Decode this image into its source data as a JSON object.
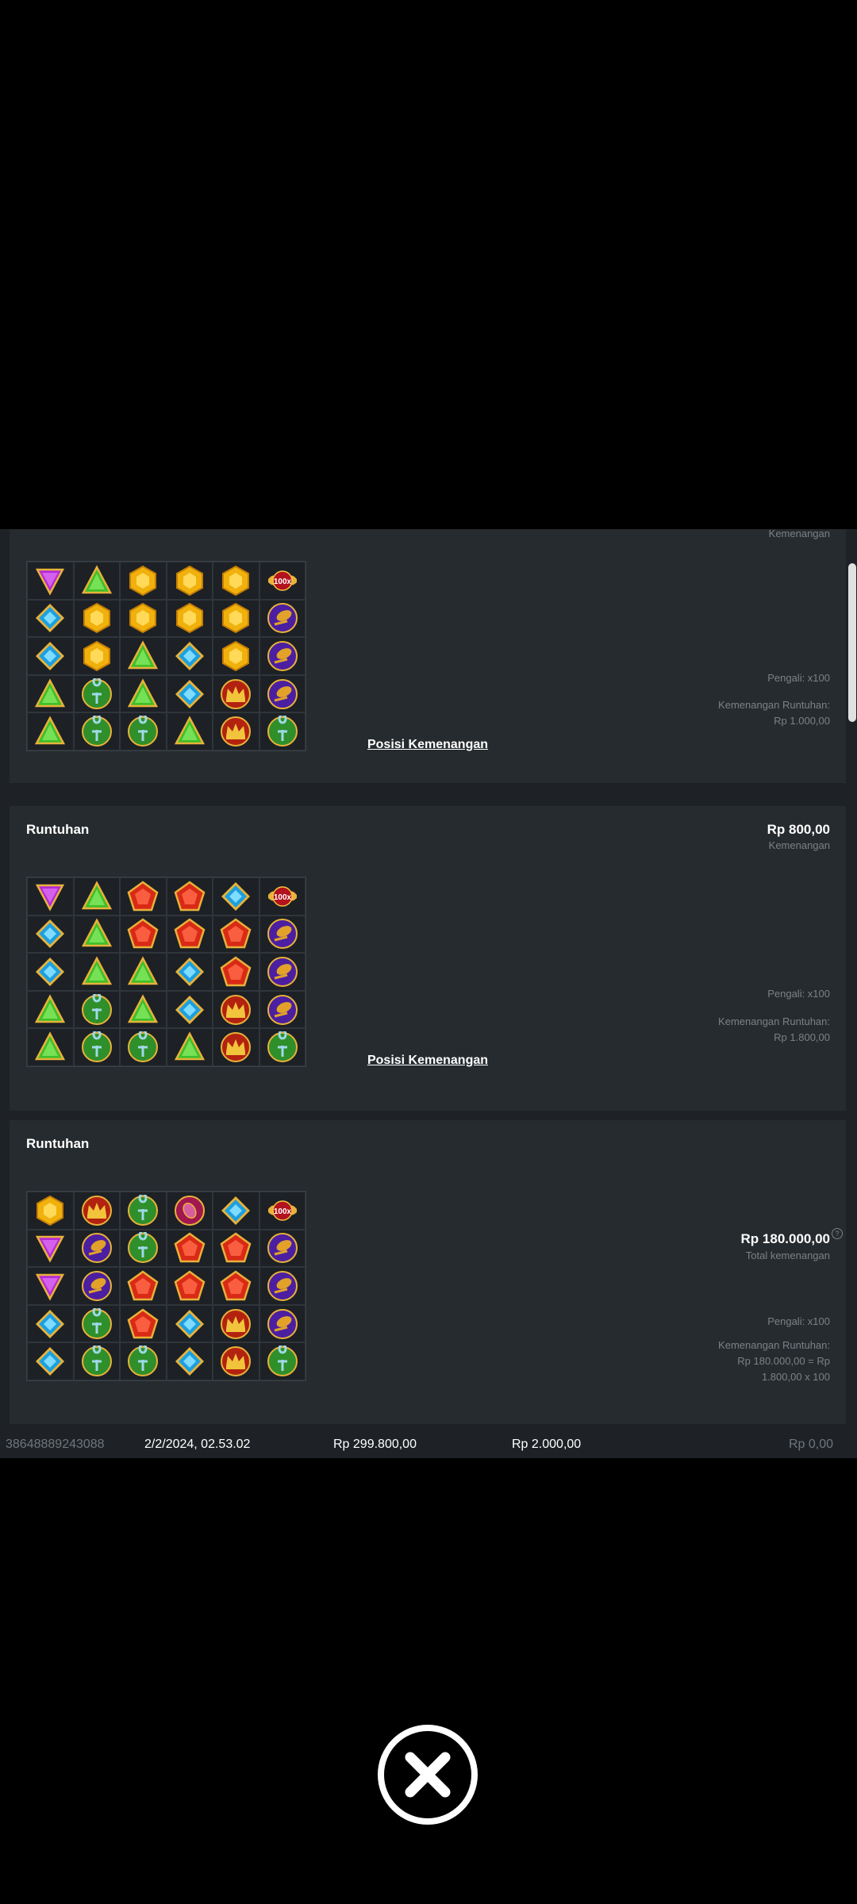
{
  "card1": {
    "win_label_top": "Kemenangan",
    "multiplier": "Pengali: x100",
    "cascade_label": "Kemenangan Runtuhan:",
    "cascade_value": "Rp 1.000,00",
    "link": "Posisi Kemenangan",
    "grid": [
      [
        "purple-triangle",
        "green-triangle",
        "gold-hexagon",
        "gold-hexagon",
        "gold-hexagon",
        "multiplier-100x"
      ],
      [
        "blue-diamond",
        "gold-hexagon",
        "gold-hexagon",
        "gold-hexagon",
        "gold-hexagon",
        "purple-scarab"
      ],
      [
        "blue-diamond",
        "gold-hexagon",
        "green-triangle",
        "blue-diamond",
        "gold-hexagon",
        "purple-scarab"
      ],
      [
        "green-triangle",
        "green-ankh",
        "green-triangle",
        "blue-diamond",
        "red-crown",
        "purple-scarab"
      ],
      [
        "green-triangle",
        "green-ankh",
        "green-ankh",
        "green-triangle",
        "red-crown",
        "green-ankh"
      ]
    ]
  },
  "card2": {
    "title": "Runtuhan",
    "amount": "Rp 800,00",
    "amount_label": "Kemenangan",
    "multiplier": "Pengali: x100",
    "cascade_label": "Kemenangan Runtuhan:",
    "cascade_value": "Rp 1.800,00",
    "link": "Posisi Kemenangan",
    "grid": [
      [
        "purple-triangle",
        "green-triangle",
        "red-pentagon",
        "red-pentagon",
        "blue-diamond",
        "multiplier-100x"
      ],
      [
        "blue-diamond",
        "green-triangle",
        "red-pentagon",
        "red-pentagon",
        "red-pentagon",
        "purple-scarab"
      ],
      [
        "blue-diamond",
        "green-triangle",
        "green-triangle",
        "blue-diamond",
        "red-pentagon",
        "purple-scarab"
      ],
      [
        "green-triangle",
        "green-ankh",
        "green-triangle",
        "blue-diamond",
        "red-crown",
        "purple-scarab"
      ],
      [
        "green-triangle",
        "green-ankh",
        "green-ankh",
        "green-triangle",
        "red-crown",
        "green-ankh"
      ]
    ]
  },
  "card3": {
    "title": "Runtuhan",
    "amount": "Rp 180.000,00",
    "amount_label": "Total kemenangan",
    "help": "?",
    "multiplier": "Pengali: x100",
    "cascade_label": "Kemenangan Runtuhan:",
    "cascade_value_1": "Rp 180.000,00 = Rp",
    "cascade_value_2": "1.800,00 x 100",
    "grid": [
      [
        "gold-hexagon",
        "red-crown",
        "green-ankh",
        "pink-scarab",
        "blue-diamond",
        "multiplier-100x"
      ],
      [
        "purple-triangle",
        "purple-scarab",
        "green-ankh",
        "red-pentagon",
        "red-pentagon",
        "purple-scarab"
      ],
      [
        "purple-triangle",
        "purple-scarab",
        "red-pentagon",
        "red-pentagon",
        "red-pentagon",
        "purple-scarab"
      ],
      [
        "blue-diamond",
        "green-ankh",
        "red-pentagon",
        "blue-diamond",
        "red-crown",
        "purple-scarab"
      ],
      [
        "blue-diamond",
        "green-ankh",
        "green-ankh",
        "blue-diamond",
        "red-crown",
        "green-ankh"
      ]
    ]
  },
  "footer": {
    "transaction_id": "38648889243088",
    "datetime": "2/2/2024, 02.53.02",
    "balance": "Rp 299.800,00",
    "bet": "Rp 2.000,00",
    "profit": "Rp 0,00"
  },
  "multiplier_badge": "100x",
  "colors": {
    "panel": "#1e2226",
    "card": "#262b2f",
    "muted_text": "#7c8186"
  }
}
